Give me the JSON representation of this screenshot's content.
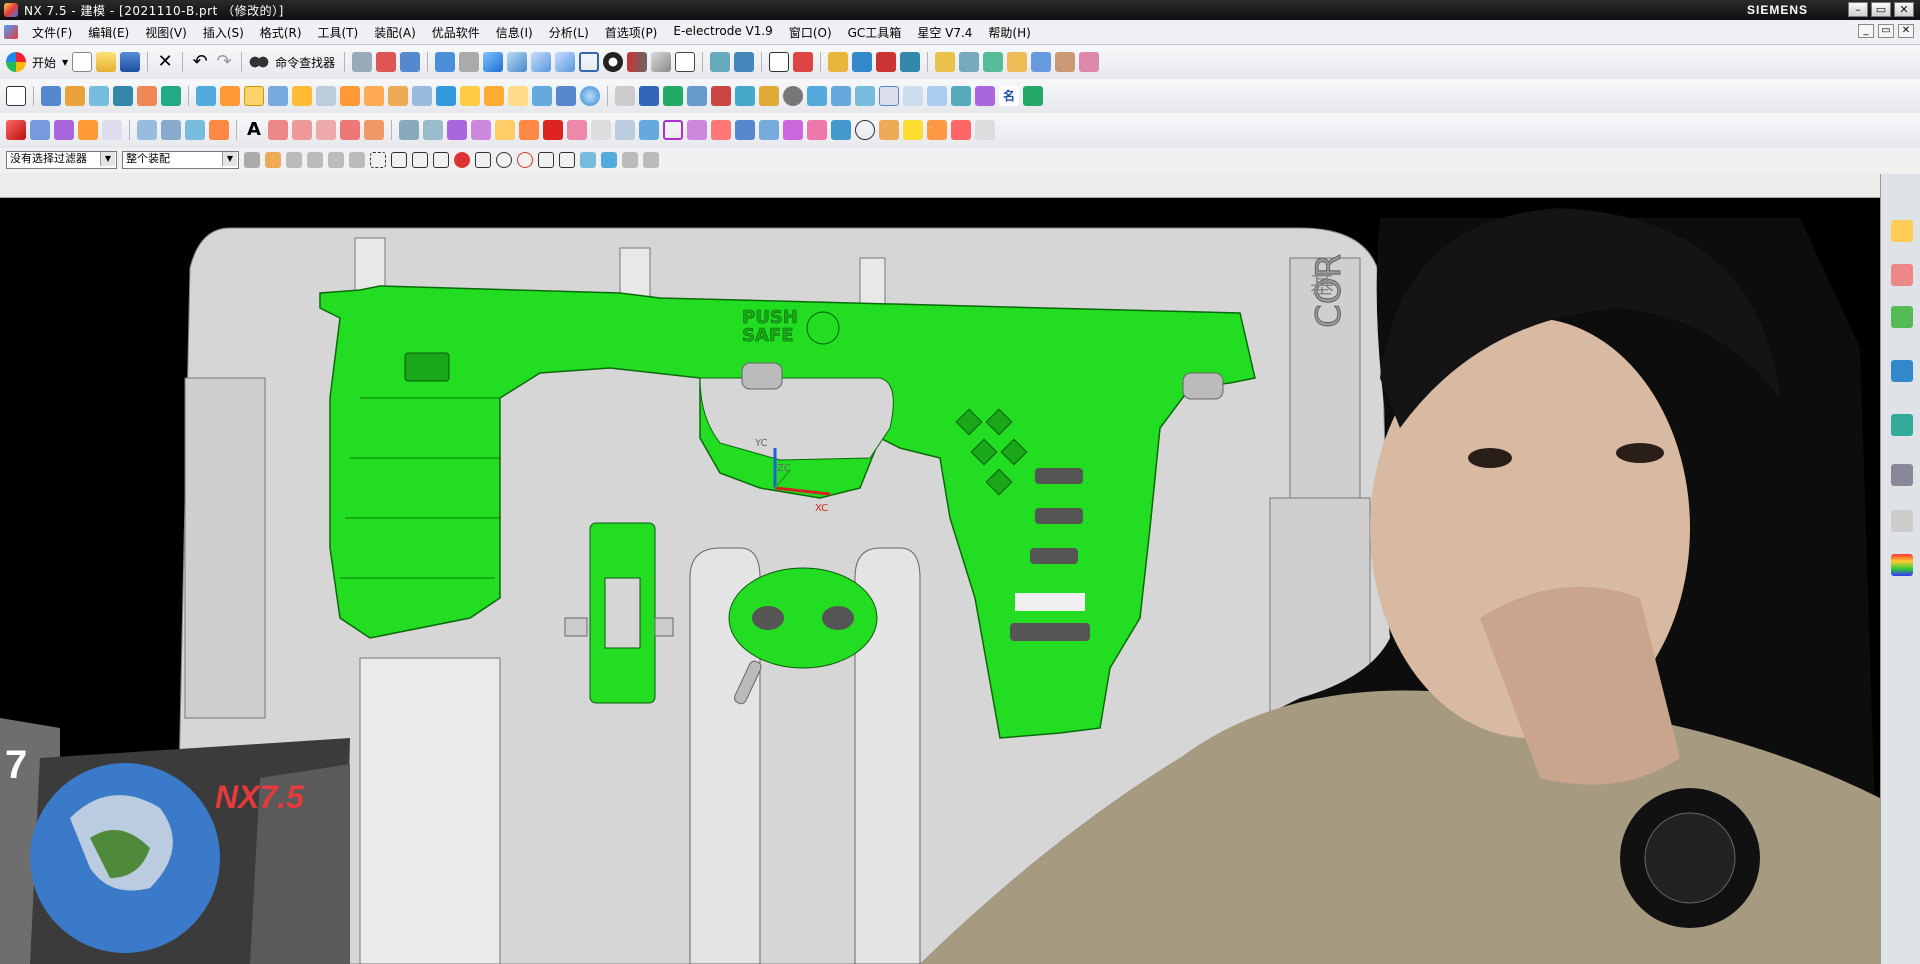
{
  "window": {
    "title": "NX 7.5 - 建模 - [2021110-B.prt （修改的）]",
    "brand": "SIEMENS",
    "controls": [
      "–",
      "▭",
      "✕"
    ]
  },
  "menubar": {
    "items": [
      "文件(F)",
      "编辑(E)",
      "视图(V)",
      "插入(S)",
      "格式(R)",
      "工具(T)",
      "装配(A)",
      "优品软件",
      "信息(I)",
      "分析(L)",
      "首选项(P)",
      "E-electrode V1.9",
      "窗口(O)",
      "GC工具箱",
      "星空 V7.4",
      "帮助(H)"
    ],
    "mdi_controls": [
      "_",
      "▭",
      "✕"
    ]
  },
  "toolbar1": {
    "start_label": "开始",
    "command_finder_label": "命令查找器"
  },
  "selection_bar": {
    "filter_value": "没有选择过滤器",
    "scope_value": "整个装配"
  },
  "viewport": {
    "background_color": "#000000",
    "mold_color": "#d6d6d6",
    "part_color": "#22dd22",
    "engraved_text_1": "PUSH",
    "engraved_text_2": "SAFE",
    "side_text": "COR",
    "side_text_2": "基",
    "wcs_y": "YC",
    "wcs_z": "ZC",
    "wcs_x": "XC",
    "splash_text": "NX7.5",
    "splash_digit": "7"
  }
}
